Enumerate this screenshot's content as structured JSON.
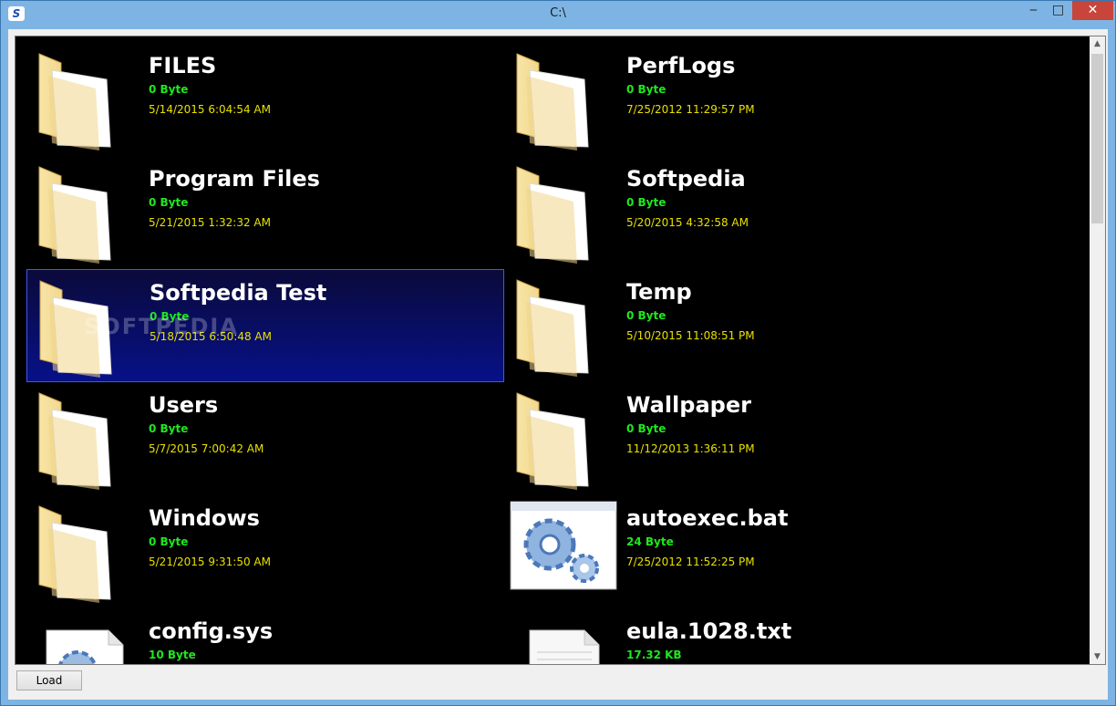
{
  "window": {
    "title": "C:\\",
    "app_icon": "S",
    "minimize": "‒",
    "maximize": "□",
    "close": "✕"
  },
  "items": [
    {
      "name": "FILES",
      "size": "0 Byte",
      "date": "5/14/2015 6:04:54 AM",
      "icon": "folder-icon"
    },
    {
      "name": "PerfLogs",
      "size": "0 Byte",
      "date": "7/25/2012 11:29:57 PM",
      "icon": "folder-icon"
    },
    {
      "name": "Program Files",
      "size": "0 Byte",
      "date": "5/21/2015 1:32:32 AM",
      "icon": "folder-icon"
    },
    {
      "name": "Softpedia",
      "size": "0 Byte",
      "date": "5/20/2015 4:32:58 AM",
      "icon": "folder-icon"
    },
    {
      "name": "Softpedia Test",
      "size": "0 Byte",
      "date": "5/18/2015 6:50:48 AM",
      "icon": "folder-icon",
      "selected": true
    },
    {
      "name": "Temp",
      "size": "0 Byte",
      "date": "5/10/2015 11:08:51 PM",
      "icon": "folder-icon"
    },
    {
      "name": "Users",
      "size": "0 Byte",
      "date": "5/7/2015 7:00:42 AM",
      "icon": "folder-icon"
    },
    {
      "name": "Wallpaper",
      "size": "0 Byte",
      "date": "11/12/2013 1:36:11 PM",
      "icon": "folder-icon"
    },
    {
      "name": "Windows",
      "size": "0 Byte",
      "date": "5/21/2015 9:31:50 AM",
      "icon": "folder-icon"
    },
    {
      "name": "autoexec.bat",
      "size": "24 Byte",
      "date": "7/25/2012 11:52:25 PM",
      "icon": "batch-file-gear-icon"
    },
    {
      "name": "config.sys",
      "size": "10 Byte",
      "date": "",
      "icon": "system-file-gear-icon"
    },
    {
      "name": "eula.1028.txt",
      "size": "17.32 KB",
      "date": "",
      "icon": "text-file-icon"
    }
  ],
  "watermark": "SOFTPEDIA",
  "footer": {
    "load_label": "Load"
  },
  "colors": {
    "name": "#ffffff",
    "size": "#1ee81e",
    "date": "#e8e000",
    "selection": "#071188"
  }
}
